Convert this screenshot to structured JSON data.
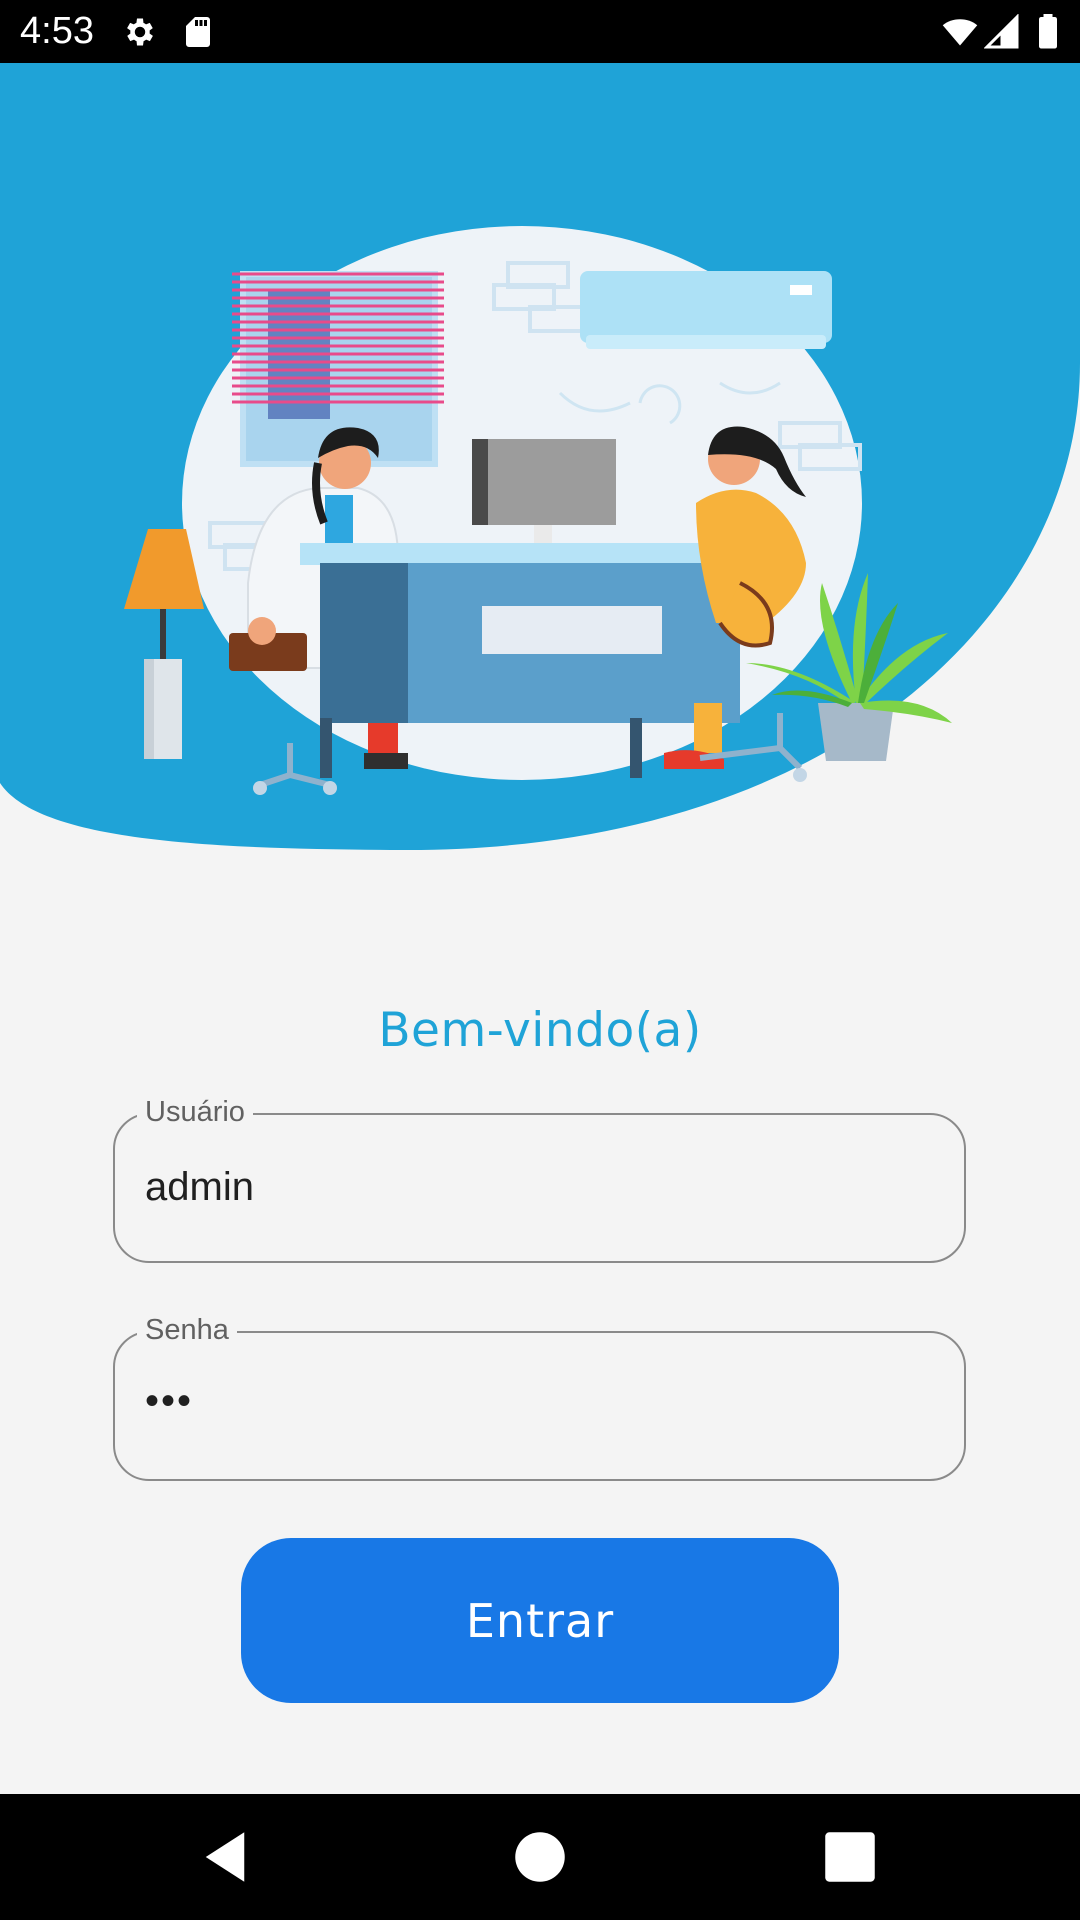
{
  "status_bar": {
    "time": "4:53",
    "icons": [
      "settings-gear-icon",
      "sd-card-icon",
      "wifi-icon",
      "signal-icon",
      "battery-icon"
    ]
  },
  "colors": {
    "header_blue": "#1fa3d7",
    "button_blue": "#1878e6",
    "welcome_text": "#1fa3d7",
    "background": "#f4f4f4"
  },
  "header": {
    "illustration": "doctor-patient-consultation-illustration"
  },
  "login": {
    "welcome": "Bem-vindo(a)",
    "username": {
      "label": "Usuário",
      "value": "admin"
    },
    "password": {
      "label": "Senha",
      "value": "•••"
    },
    "submit_label": "Entrar"
  },
  "nav_bar": {
    "buttons": [
      "back-icon",
      "home-icon",
      "recents-icon"
    ]
  }
}
